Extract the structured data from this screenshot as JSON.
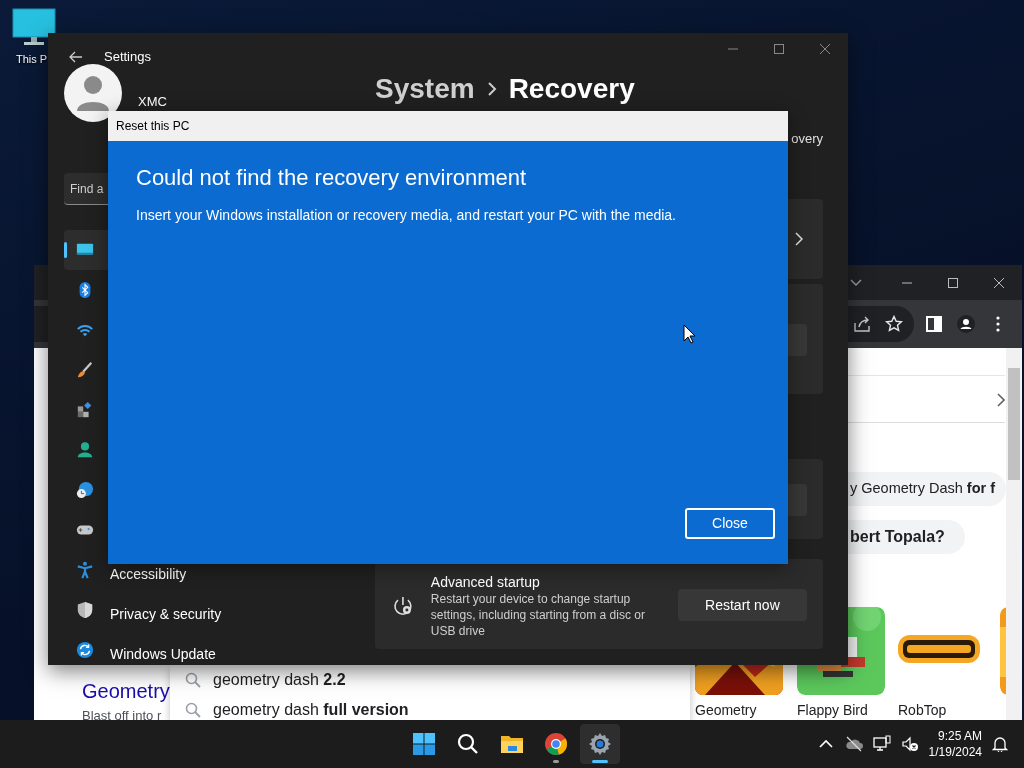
{
  "desktop": {
    "icons": [
      {
        "label": "This P"
      }
    ]
  },
  "browser": {
    "related": "y Geometry Dash **for f**",
    "question": "bert Topala?",
    "result": {
      "title": "Geometry",
      "snippet": "Blast off into r"
    },
    "suggestions": [
      "geometry dash **2.2**",
      "geometry dash **full version**"
    ],
    "tiles": [
      {
        "kind": "geometry",
        "label": "Geometry"
      },
      {
        "kind": "flappy",
        "label": "Flappy Bird"
      },
      {
        "kind": "robtop",
        "label": "RobTop"
      },
      {
        "kind": "orange"
      }
    ]
  },
  "settings": {
    "title": "Settings",
    "user": "XMC",
    "search": {
      "placeholder": "Find a"
    },
    "breadcrumb": {
      "parent": "System",
      "current": "Recovery"
    },
    "subtitle": "overy",
    "nav": [
      {
        "kind": "system",
        "selected": true
      },
      {
        "kind": "bluetooth",
        "selected": false
      },
      {
        "kind": "network",
        "selected": false
      },
      {
        "kind": "personalization",
        "selected": false
      },
      {
        "kind": "apps",
        "selected": false
      },
      {
        "kind": "accounts",
        "selected": false
      },
      {
        "kind": "time",
        "selected": false
      },
      {
        "kind": "gaming",
        "selected": false
      },
      {
        "kind": "accessibility",
        "label": "Accessibility",
        "selected": false
      },
      {
        "kind": "privacy",
        "label": "Privacy & security",
        "selected": false
      },
      {
        "kind": "update",
        "label": "Windows Update",
        "selected": false
      }
    ],
    "cards": [
      {
        "kind": "link"
      },
      {
        "kind": "button"
      },
      {
        "kind": "button"
      }
    ],
    "advanced_startup": {
      "title": "Advanced startup",
      "description": "Restart your device to change startup settings, including starting from a disc or USB drive",
      "button": "Restart now"
    }
  },
  "dialog": {
    "title": "Reset this PC",
    "heading": "Could not find the recovery environment",
    "message": "Insert your Windows installation or recovery media, and restart your PC with the media.",
    "button": "Close"
  },
  "taskbar": {
    "apps": [
      {
        "kind": "start",
        "selected": false,
        "running": false
      },
      {
        "kind": "search",
        "selected": false,
        "running": false
      },
      {
        "kind": "explorer",
        "selected": false,
        "running": false
      },
      {
        "kind": "chrome",
        "selected": false,
        "running": true
      },
      {
        "kind": "settings",
        "selected": true,
        "running": true
      }
    ],
    "time": "9:25 AM",
    "date": "1/19/2024"
  }
}
